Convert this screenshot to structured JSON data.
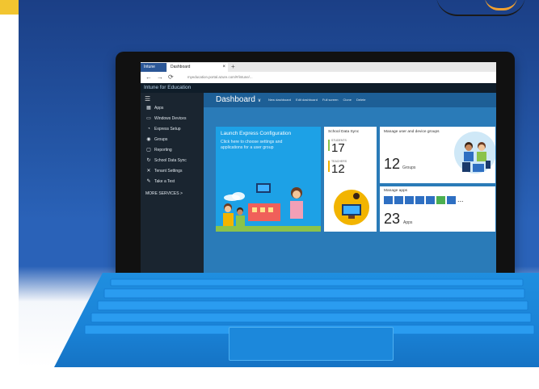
{
  "browser": {
    "tabs": [
      {
        "label": "Intune"
      },
      {
        "label": "Dashboard"
      }
    ],
    "new_tab_glyph": "+",
    "close_glyph": "×",
    "nav": {
      "back": "←",
      "forward": "→",
      "refresh": "⟳"
    },
    "url": "myeducation.portal.azure.com/#/intune/..."
  },
  "app": {
    "title": "Intune for Education",
    "sidebar": {
      "items": [
        {
          "label": "Apps",
          "icon": "apps-icon"
        },
        {
          "label": "Windows Devices",
          "icon": "device-icon"
        },
        {
          "label": "Express Setup",
          "icon": "express-setup-icon"
        },
        {
          "label": "Groups",
          "icon": "groups-icon"
        },
        {
          "label": "Reporting",
          "icon": "report-icon"
        },
        {
          "label": "School Data Sync",
          "icon": "sync-icon"
        },
        {
          "label": "Tenant Settings",
          "icon": "settings-icon"
        },
        {
          "label": "Take a Test",
          "icon": "pen-icon"
        }
      ],
      "more": "MORE SERVICES >"
    },
    "dashboard": {
      "title": "Dashboard",
      "title_chevron": "∨",
      "commands": [
        "New dashboard",
        "Edit dashboard",
        "Full screen",
        "Clone",
        "Delete"
      ],
      "launch": {
        "title": "Launch Express Configuration",
        "subtitle": "Click here to choose settings and applications for a user group"
      },
      "sds": {
        "title": "School Data Sync",
        "rows": [
          {
            "value": "17",
            "label": "STUDENTS",
            "color": "#8bc34a"
          },
          {
            "value": "12",
            "label": "TEACHERS",
            "color": "#f2b400"
          }
        ]
      },
      "users": {
        "title": "Manage user and device groups",
        "value": "12",
        "label": "Groups"
      },
      "apps": {
        "title": "Manage apps",
        "value": "23",
        "label": "Apps",
        "more": "..."
      }
    }
  }
}
